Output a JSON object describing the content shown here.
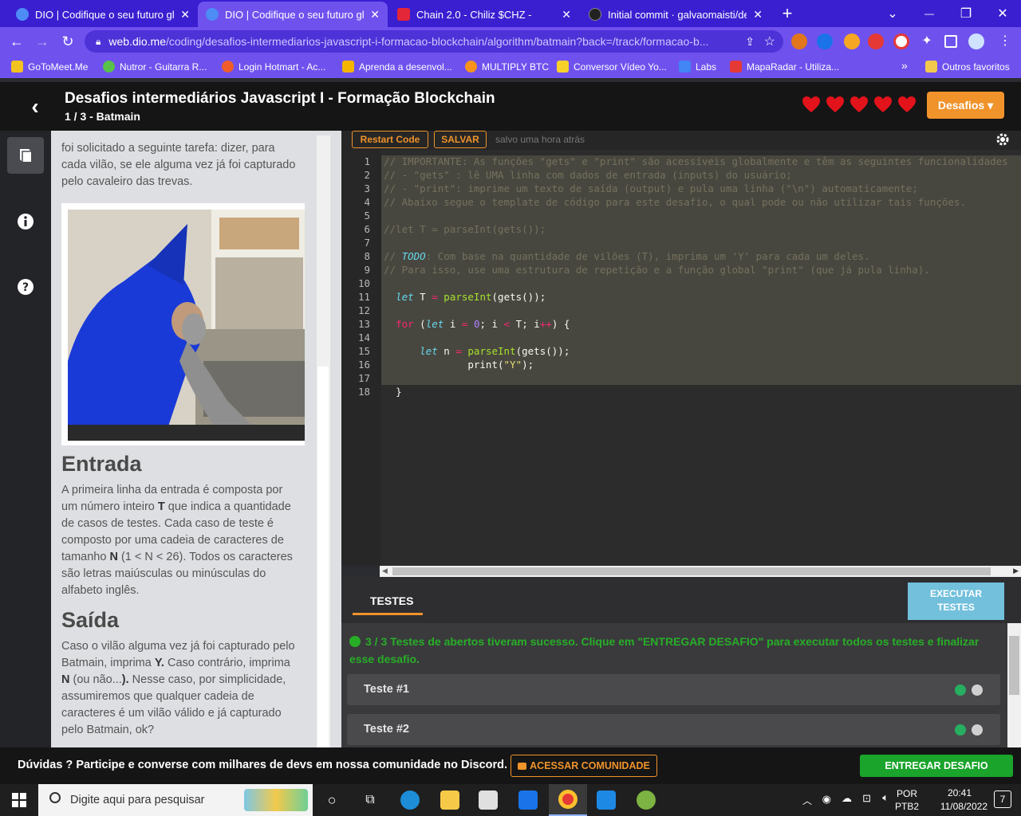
{
  "browser": {
    "tabs": [
      {
        "title": "DIO | Codifique o seu futuro glob",
        "close": "✕",
        "favicon_color": "#4e8cf5",
        "active": false
      },
      {
        "title": "DIO | Codifique o seu futuro glob",
        "close": "✕",
        "favicon_color": "#4e8cf5",
        "active": true
      },
      {
        "title": "Chain 2.0 - Chiliz $CHZ -",
        "close": "✕",
        "favicon_color": "#e32638",
        "active": false
      },
      {
        "title": "Initial commit · galvaomaisti/des",
        "close": "✕",
        "favicon_color": "#222222",
        "active": false
      }
    ],
    "new_tab": "+",
    "tab_search": "⌄",
    "minimize": "—",
    "maximize": "❐",
    "close": "✕",
    "url_host": "web.dio.me",
    "url_path": "/coding/desafios-intermediarios-javascript-i-formacao-blockchain/algorithm/batmain?back=/track/formacao-b...",
    "bookmarks": [
      {
        "label": "GoToMeet.Me",
        "color": "#f2c31f"
      },
      {
        "label": "Nutror - Guitarra R...",
        "color": "#58c24a"
      },
      {
        "label": "Login Hotmart - Ac...",
        "color": "#f05d2b"
      },
      {
        "label": "Aprenda a desenvol...",
        "color": "#f4b400"
      },
      {
        "label": "MULTIPLY BTC",
        "color": "#f7931a"
      },
      {
        "label": "Conversor Vídeo Yo...",
        "color": "#f7d12a"
      },
      {
        "label": "Labs",
        "color": "#4285f4"
      },
      {
        "label": "MapaRadar - Utiliza...",
        "color": "#e53935"
      }
    ],
    "bookmarks_more": "»",
    "other_bookmarks": "Outros favoritos"
  },
  "header": {
    "title": "Desafios intermediários Javascript I - Formação Blockchain",
    "subtitle": "1 / 3 - Batmain",
    "lives": 5,
    "heart_color": "#e3131b",
    "desafios_label": "Desafios ▾"
  },
  "description": {
    "intro": "foi solicitado a seguinte tarefa: dizer, para cada vilão, se ele alguma vez já foi capturado pelo cavaleiro das trevas.",
    "input_heading": "Entrada",
    "input_p1": "A primeira linha da entrada é composta por um número inteiro ",
    "input_T": "T",
    "input_p2": " que indica a quantidade de casos de testes. Cada caso de teste é composto por uma cadeia de caracteres de tamanho ",
    "input_N": "N",
    "input_p3": " (1 < N < 26). Todos os caracteres são letras maiúsculas ou minúsculas do alfabeto inglês.",
    "output_heading": "Saída",
    "output_p1": "Caso o vilão alguma vez já foi capturado pelo Batmain, imprima ",
    "output_Y": "Y.",
    "output_p2": " Caso contrário, imprima ",
    "output_N": "N",
    "output_p3": " (ou não...",
    "output_paren": ").",
    "output_p4": " Nesse caso, por simplicidade, assumiremos que qualquer cadeia de caracteres é um vilão válido e já capturado pelo Batmain, ok?"
  },
  "editor": {
    "restart_label": "Restart Code",
    "save_label": "SALVAR",
    "saved_status": "salvo uma hora atrás",
    "line_numbers": [
      "1",
      "2",
      "3",
      "4",
      "5",
      "6",
      "7",
      "8",
      "9",
      "10",
      "11",
      "12",
      "13",
      "14",
      "15",
      "16",
      "17",
      "18"
    ],
    "code": {
      "l1": "// IMPORTANTE: As funções \"gets\" e \"print\" são acessíveis globalmente e têm as seguintes funcionalidades",
      "l2": "// - \"gets\" : lê UMA linha com dados de entrada (inputs) do usuário;",
      "l3": "// - \"print\": imprime um texto de saída (output) e pula uma linha (\"\\n\") automaticamente;",
      "l4": "// Abaixo segue o template de código para este desafio, o qual pode ou não utilizar tais funções.",
      "l6": "//let T = parseInt(gets());",
      "l8a": "// ",
      "l8b": "TODO",
      "l8c": ": Com base na quantidade de vilões (T), imprima um 'Y' para cada um deles.",
      "l9": "// Para isso, use uma estrutura de repetição e a função global \"print\" (que já pula linha).",
      "let": "let",
      "for": "for",
      "T": "T",
      "i": "i",
      "n": "n",
      "eq": "=",
      "lt": "<",
      "inc": "++",
      "zero": "0",
      "parseInt": "parseInt",
      "print": "print",
      "Ystr": "\"Y\"",
      "close_brace": "}"
    }
  },
  "tests": {
    "tab_label": "TESTES",
    "execute_label_1": "EXECUTAR",
    "execute_label_2": "TESTES",
    "success_message": "3 / 3 Testes de abertos tiveram sucesso. Clique em \"ENTREGAR DESAFIO\" para executar todos os testes e finalizar esse desafio.",
    "items": [
      {
        "label": "Teste #1",
        "passed": true
      },
      {
        "label": "Teste #2",
        "passed": true
      }
    ]
  },
  "footer": {
    "discord_text": "Dúvidas ?  Participe e converse com milhares de devs em nossa comunidade no Discord.",
    "community_label": "ACESSAR COMUNIDADE",
    "submit_label": "ENTREGAR DESAFIO"
  },
  "taskbar": {
    "search_placeholder": "Digite aqui para pesquisar",
    "lang_top": "POR",
    "lang_bottom": "PTB2",
    "time": "20:41",
    "date": "11/08/2022",
    "notifications": "7"
  }
}
